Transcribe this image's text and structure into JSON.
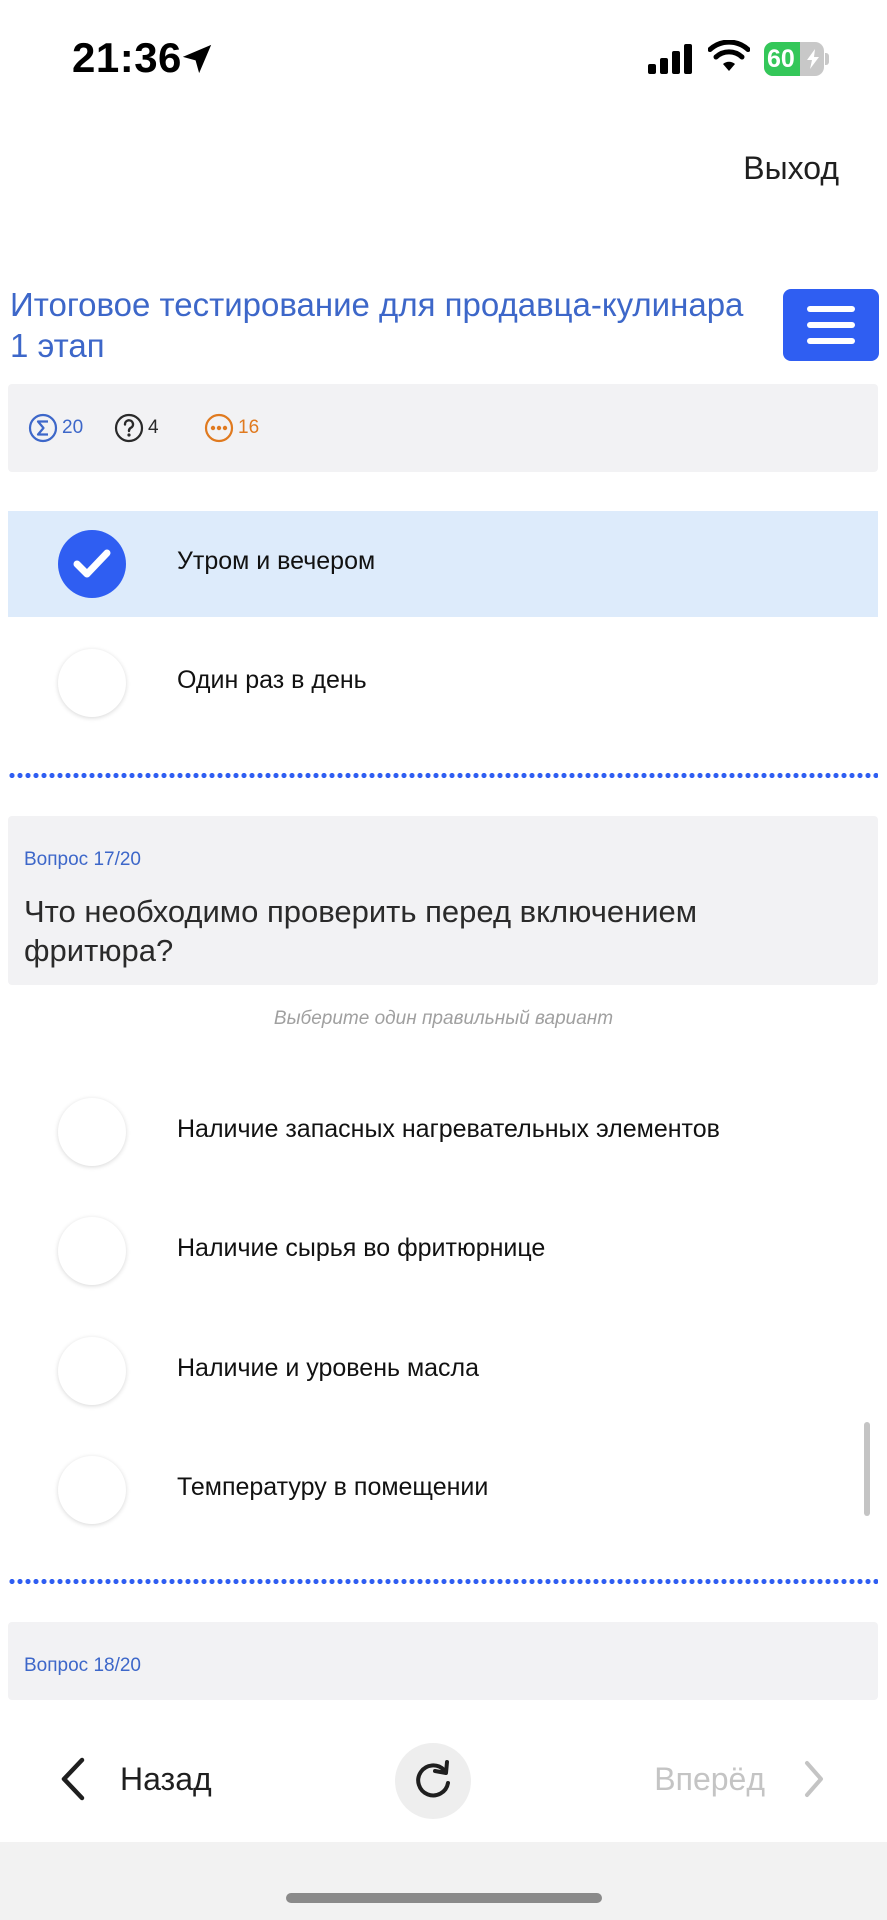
{
  "status_bar": {
    "time": "21:36",
    "battery_level": "60",
    "battery_fraction": 0.6,
    "icons": [
      "location-arrow-icon",
      "cellular-signal-icon",
      "wifi-icon",
      "battery-charging-icon"
    ]
  },
  "header": {
    "exit_label": "Выход",
    "title": "Итоговое тестирование для продавца-кулинара 1 этап",
    "menu_icon": "hamburger-menu-icon"
  },
  "stats": {
    "total": "20",
    "unanswered": "4",
    "remaining": "16",
    "icons": [
      "sigma-circle-icon",
      "question-circle-icon",
      "ellipsis-circle-icon"
    ]
  },
  "previous_question": {
    "options": [
      {
        "label": "Утром и вечером",
        "selected": true
      },
      {
        "label": "Один раз в день",
        "selected": false
      }
    ]
  },
  "question_17": {
    "number": "Вопрос 17/20",
    "text": "Что необходимо проверить перед включением фритюра?",
    "hint": "Выберите один правильный вариант",
    "options": [
      {
        "label": "Наличие запасных нагревательных элементов",
        "selected": false
      },
      {
        "label": "Наличие сырья во фритюрнице",
        "selected": false
      },
      {
        "label": "Наличие и уровень масла",
        "selected": false
      },
      {
        "label": "Температуру в помещении",
        "selected": false
      }
    ]
  },
  "question_18": {
    "number": "Вопрос 18/20"
  },
  "bottom_nav": {
    "back_label": "Назад",
    "next_label": "Вперёд",
    "icons": [
      "chevron-left-icon",
      "refresh-icon",
      "chevron-right-icon"
    ]
  },
  "colors": {
    "accent": "#2f5ef2",
    "title_blue": "#3d67c9",
    "selected_bg": "#ddebfb",
    "panel_bg": "#f2f2f4",
    "remaining_orange": "#e07a1f",
    "battery_green": "#34c759",
    "disabled_text": "#c4c4c4"
  }
}
